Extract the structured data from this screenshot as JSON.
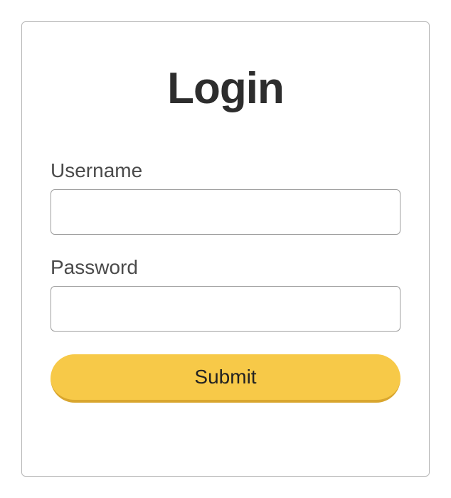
{
  "form": {
    "title": "Login",
    "username": {
      "label": "Username",
      "value": ""
    },
    "password": {
      "label": "Password",
      "value": ""
    },
    "submit_label": "Submit"
  },
  "colors": {
    "accent": "#f7c948",
    "accent_shadow": "#d9a62e",
    "border": "#9e9e9e",
    "text_dark": "#2d2d2d",
    "text_label": "#4a4a4a"
  }
}
